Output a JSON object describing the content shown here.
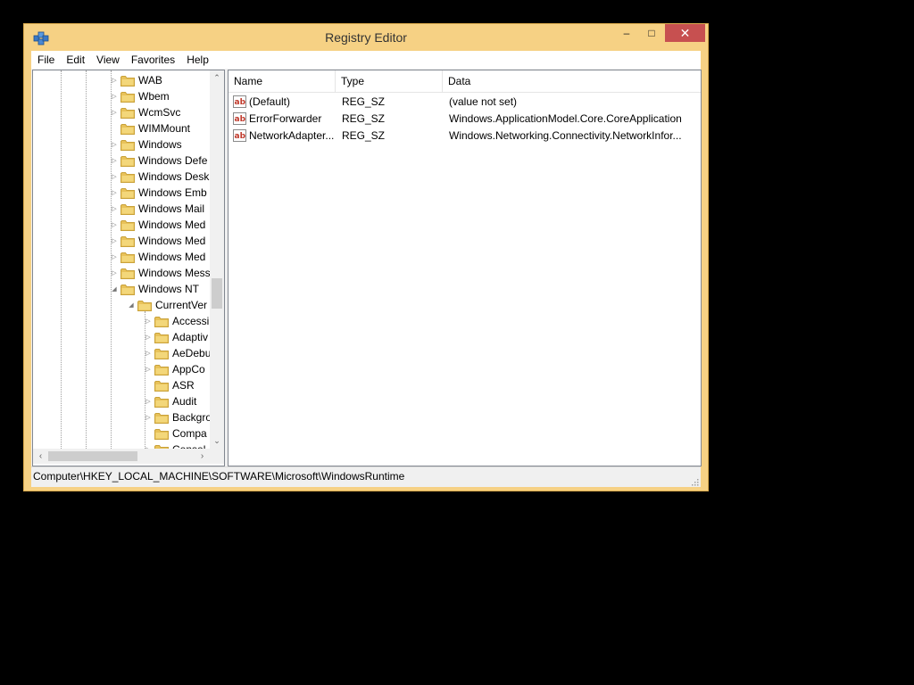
{
  "window": {
    "title": "Registry Editor",
    "minimize": "–",
    "maximize": "□",
    "close": "✕",
    "accent": "#f6d184",
    "close_color": "#c75050"
  },
  "menu": [
    "File",
    "Edit",
    "View",
    "Favorites",
    "Help"
  ],
  "tree": {
    "items": [
      {
        "label": "WAB",
        "level": 0,
        "expander": "▷"
      },
      {
        "label": "Wbem",
        "level": 0,
        "expander": "▷"
      },
      {
        "label": "WcmSvc",
        "level": 0,
        "expander": "▷"
      },
      {
        "label": "WIMMount",
        "level": 0,
        "expander": ""
      },
      {
        "label": "Windows",
        "level": 0,
        "expander": "▷"
      },
      {
        "label": "Windows Defe",
        "level": 0,
        "expander": "▷"
      },
      {
        "label": "Windows Desk",
        "level": 0,
        "expander": "▷"
      },
      {
        "label": "Windows Emb",
        "level": 0,
        "expander": "▷"
      },
      {
        "label": "Windows Mail",
        "level": 0,
        "expander": "▷"
      },
      {
        "label": "Windows Med",
        "level": 0,
        "expander": "▷"
      },
      {
        "label": "Windows Med",
        "level": 0,
        "expander": "▷"
      },
      {
        "label": "Windows Med",
        "level": 0,
        "expander": "▷"
      },
      {
        "label": "Windows Mess",
        "level": 0,
        "expander": "▷"
      },
      {
        "label": "Windows NT",
        "level": 0,
        "expander": "◢"
      },
      {
        "label": "CurrentVer",
        "level": 1,
        "expander": "◢"
      },
      {
        "label": "Accessi",
        "level": 2,
        "expander": "▷"
      },
      {
        "label": "Adaptiv",
        "level": 2,
        "expander": "▷"
      },
      {
        "label": "AeDebu",
        "level": 2,
        "expander": "▷"
      },
      {
        "label": "AppCo",
        "level": 2,
        "expander": "▷"
      },
      {
        "label": "ASR",
        "level": 2,
        "expander": ""
      },
      {
        "label": "Audit",
        "level": 2,
        "expander": "▷"
      },
      {
        "label": "Backgro",
        "level": 2,
        "expander": "▷"
      },
      {
        "label": "Compa",
        "level": 2,
        "expander": ""
      },
      {
        "label": "Consol",
        "level": 2,
        "expander": "▷"
      }
    ],
    "scroll_up": "⌃",
    "scroll_down": "⌄",
    "scroll_left": "‹",
    "scroll_right": "›"
  },
  "list": {
    "columns": [
      "Name",
      "Type",
      "Data"
    ],
    "rows": [
      {
        "name": "(Default)",
        "type": "REG_SZ",
        "data": "(value not set)",
        "icon": "reg-sz-icon"
      },
      {
        "name": "ErrorForwarder",
        "type": "REG_SZ",
        "data": "Windows.ApplicationModel.Core.CoreApplication",
        "icon": "reg-sz-icon"
      },
      {
        "name": "NetworkAdapter...",
        "type": "REG_SZ",
        "data": "Windows.Networking.Connectivity.NetworkInfor...",
        "icon": "reg-sz-icon"
      }
    ]
  },
  "status": {
    "path": "Computer\\HKEY_LOCAL_MACHINE\\SOFTWARE\\Microsoft\\WindowsRuntime"
  }
}
